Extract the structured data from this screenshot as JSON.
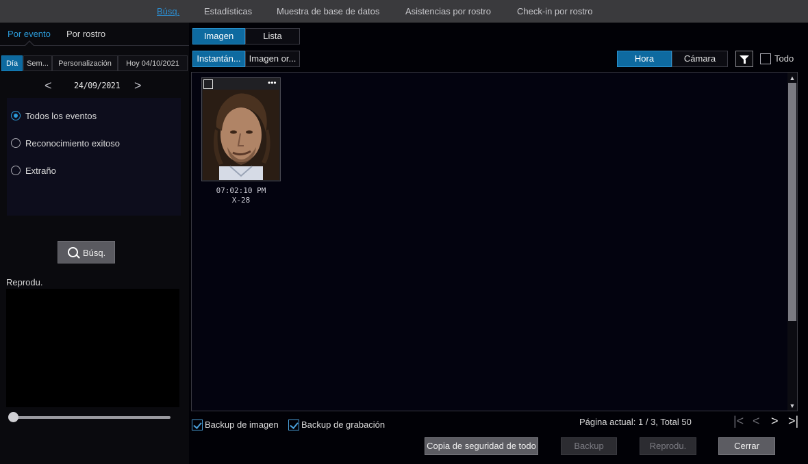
{
  "top_nav": [
    "Búsq.",
    "Estadísticas",
    "Muestra de base de datos",
    "Asistencias por rostro",
    "Check-in por rostro"
  ],
  "left_tabs": {
    "event": "Por evento",
    "face": "Por rostro"
  },
  "period_segments": [
    "Día",
    "Sem...",
    "Personalización",
    "Hoy 04/10/2021"
  ],
  "date_nav": {
    "prev": "<",
    "date": "24/09/2021",
    "next": ">"
  },
  "event_options": [
    "Todos los eventos",
    "Reconocimiento exitoso",
    "Extraño"
  ],
  "selected_event": "Todos los eventos",
  "search_button": "Búsq.",
  "playback_label": "Reprodu.",
  "view_tabs": {
    "image": "Imagen",
    "list": "Lista"
  },
  "image_type_tabs": {
    "snapshot": "Instantán...",
    "original": "Imagen or..."
  },
  "sort_tabs": {
    "time": "Hora",
    "camera": "Cámara"
  },
  "select_all_label": "Todo",
  "results": [
    {
      "time": "07:02:10 PM",
      "camera": "X-28"
    }
  ],
  "thumb_menu": "•••",
  "backup_options": {
    "image": "Backup de imagen",
    "image_checked": true,
    "recording": "Backup de grabación",
    "recording_checked": true
  },
  "pagination": {
    "text": "Página actual: 1 / 3, Total 50",
    "current": 1,
    "total_pages": 3,
    "total_items": 50
  },
  "bottom_buttons": {
    "backup_all": "Copia de seguridad de todo",
    "backup": "Backup",
    "play": "Reprodu.",
    "close": "Cerrar"
  },
  "colors": {
    "accent": "#0e6aa0",
    "active_text": "#2b9ad8",
    "background": "#010106"
  }
}
